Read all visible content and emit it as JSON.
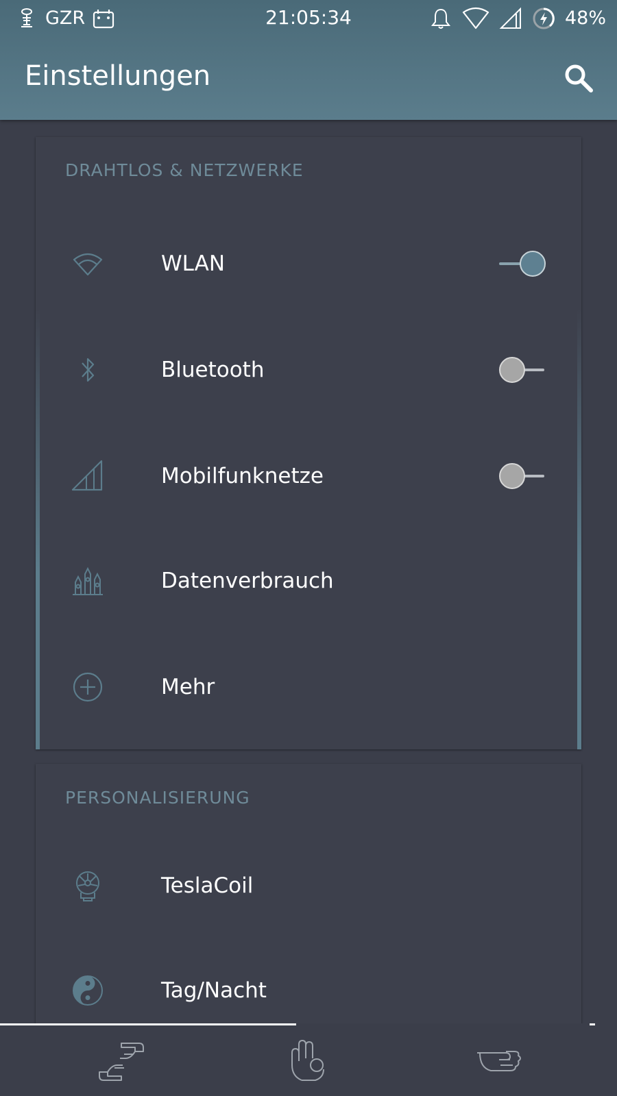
{
  "status_bar": {
    "carrier": "GZR",
    "time": "21:05:34",
    "battery": "48%",
    "icons_left": [
      "tesla-coil-notification-icon",
      "calendar-notification-icon"
    ],
    "icons_right": [
      "bell-icon",
      "wifi-icon",
      "cell-signal-icon",
      "battery-charging-icon"
    ]
  },
  "toolbar": {
    "title": "Einstellungen",
    "action_icon": "search-icon"
  },
  "sections": [
    {
      "title": "DRAHTLOS & NETZWERKE",
      "items": [
        {
          "label": "WLAN",
          "icon": "wifi-icon",
          "toggle": "on"
        },
        {
          "label": "Bluetooth",
          "icon": "bluetooth-icon",
          "toggle": "off"
        },
        {
          "label": "Mobilfunknetze",
          "icon": "cell-signal-icon",
          "toggle": "off"
        },
        {
          "label": "Datenverbrauch",
          "icon": "data-usage-icon"
        },
        {
          "label": "Mehr",
          "icon": "plus-circle-icon"
        }
      ]
    },
    {
      "title": "PERSONALISIERUNG",
      "items": [
        {
          "label": "TeslaCoil",
          "icon": "tesla-coil-icon"
        },
        {
          "label": "Tag/Nacht",
          "icon": "yin-yang-icon"
        }
      ]
    }
  ],
  "bottom_nav": {
    "tabs": [
      "frame-hands-icon",
      "ok-hand-icon",
      "pointing-hand-icon"
    ],
    "active_tab": 0
  },
  "colors": {
    "accent": "#5e8091",
    "header": "#527381",
    "background": "#3b3e4a",
    "section_title": "#6f8b99"
  }
}
